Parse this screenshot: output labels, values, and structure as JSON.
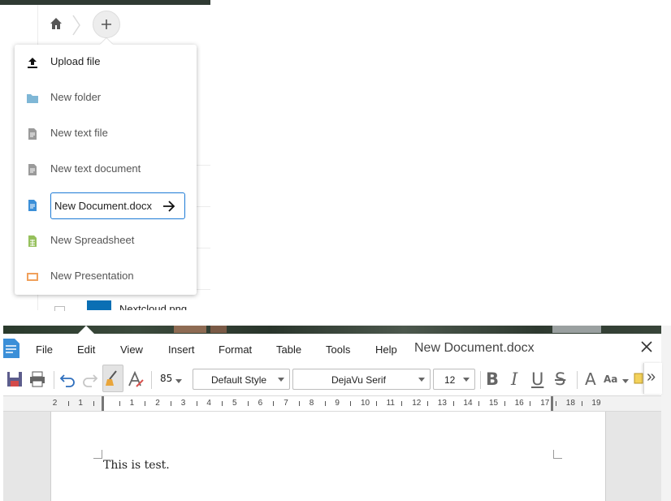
{
  "files_app": {
    "menu": {
      "upload": "Upload file",
      "new_folder": "New folder",
      "new_text_file": "New text file",
      "new_text_document": "New text document",
      "filename_input_value": "New Document.docx",
      "new_spreadsheet": "New Spreadsheet",
      "new_presentation": "New Presentation"
    },
    "partial_file_name": "Nextcloud.png"
  },
  "editor": {
    "menu": [
      "File",
      "Edit",
      "View",
      "Insert",
      "Format",
      "Table",
      "Tools",
      "Help"
    ],
    "doc_title": "New Document.docx",
    "toolbar": {
      "zoom": "85",
      "paragraph_style": "Default Style",
      "font_name": "DejaVu Serif",
      "font_size": "12",
      "bold": "B",
      "italic": "I",
      "underline": "U",
      "strike": "S",
      "grow_font": "A",
      "case": "Aa",
      "more": "»"
    },
    "ruler_left": [
      "2",
      "1"
    ],
    "ruler": [
      "1",
      "2",
      "3",
      "4",
      "5",
      "6",
      "7",
      "8",
      "9",
      "10",
      "11",
      "12",
      "13",
      "14",
      "15",
      "16",
      "17"
    ],
    "ruler_right": [
      "18",
      "19"
    ],
    "doc_text": "This is test."
  },
  "colors": {
    "accent": "#1d7bd6",
    "folder": "#7fb7d6",
    "doc": "#3b8fd8",
    "sheet": "#96c05c",
    "slides": "#f0a05b"
  }
}
